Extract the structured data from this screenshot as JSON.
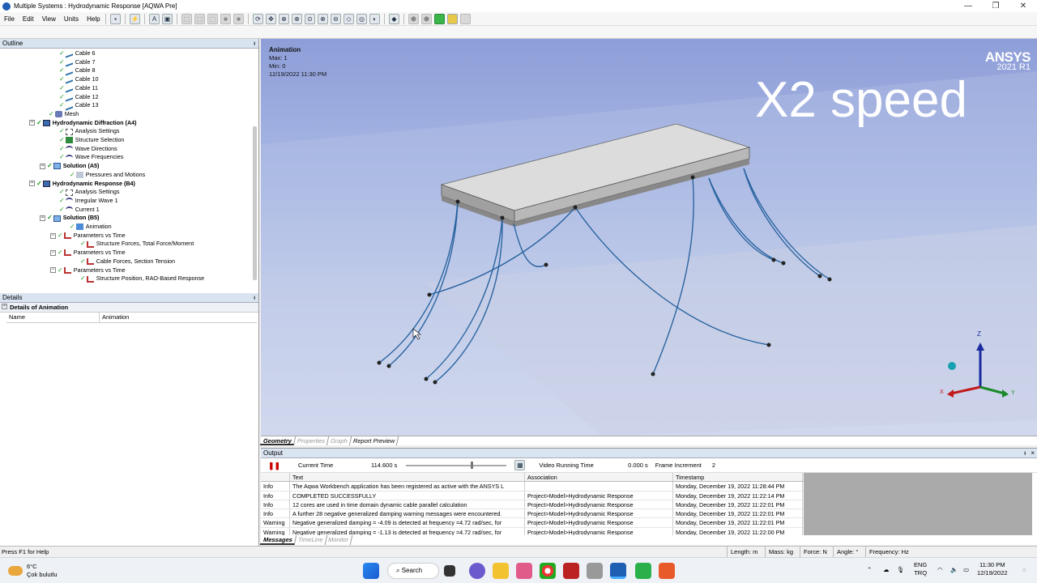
{
  "window": {
    "title": "Multiple Systems : Hydrodynamic Response [AQWA Pre]"
  },
  "menu": [
    "File",
    "Edit",
    "View",
    "Units",
    "Help"
  ],
  "outline": {
    "header": "Outline",
    "pin": "ᵻ",
    "nodes": [
      {
        "label": "Cable 6",
        "depth": 5,
        "icon": "cable-icon",
        "bold": false
      },
      {
        "label": "Cable 7",
        "depth": 5,
        "icon": "cable-icon",
        "bold": false
      },
      {
        "label": "Cable 8",
        "depth": 5,
        "icon": "cable-icon",
        "bold": false
      },
      {
        "label": "Cable 10",
        "depth": 5,
        "icon": "cable-icon",
        "bold": false
      },
      {
        "label": "Cable 11",
        "depth": 5,
        "icon": "cable-icon",
        "bold": false
      },
      {
        "label": "Cable 12",
        "depth": 5,
        "icon": "cable-icon",
        "bold": false
      },
      {
        "label": "Cable 13",
        "depth": 5,
        "icon": "cable-icon",
        "bold": false
      },
      {
        "label": "Mesh",
        "depth": 4,
        "icon": "mesh-icon",
        "bold": false
      },
      {
        "label": "Hydrodynamic Diffraction (A4)",
        "depth": 3,
        "icon": "system-icon",
        "bold": true,
        "exp": "−"
      },
      {
        "label": "Analysis Settings",
        "depth": 5,
        "icon": "settings-icon",
        "bold": false
      },
      {
        "label": "Structure Selection",
        "depth": 5,
        "icon": "structure-icon",
        "bold": false
      },
      {
        "label": "Wave Directions",
        "depth": 5,
        "icon": "wave-icon",
        "bold": false
      },
      {
        "label": "Wave Frequencies",
        "depth": 5,
        "icon": "wave-icon",
        "bold": false
      },
      {
        "label": "Solution (A5)",
        "depth": 4,
        "icon": "solution-icon",
        "bold": true,
        "exp": "−"
      },
      {
        "label": "Pressures and Motions",
        "depth": 6,
        "icon": "result-icon",
        "bold": false
      },
      {
        "label": "Hydrodynamic Response (B4)",
        "depth": 3,
        "icon": "system-icon",
        "bold": true,
        "exp": "−"
      },
      {
        "label": "Analysis Settings",
        "depth": 5,
        "icon": "settings-icon",
        "bold": false
      },
      {
        "label": "Irregular Wave 1",
        "depth": 5,
        "icon": "wave-icon",
        "bold": false
      },
      {
        "label": "Current 1",
        "depth": 5,
        "icon": "wave-icon",
        "bold": false
      },
      {
        "label": "Solution (B5)",
        "depth": 4,
        "icon": "solution-icon",
        "bold": true,
        "exp": "−"
      },
      {
        "label": "Animation",
        "depth": 6,
        "icon": "animation-icon",
        "bold": false
      },
      {
        "label": "Parameters vs Time",
        "depth": 5,
        "icon": "graph-icon",
        "bold": false,
        "exp": "−"
      },
      {
        "label": "Structure Forces, Total Force/Moment",
        "depth": 7,
        "icon": "graph-icon",
        "bold": false
      },
      {
        "label": "Parameters vs Time",
        "depth": 5,
        "icon": "graph-icon",
        "bold": false,
        "exp": "−"
      },
      {
        "label": "Cable Forces, Section Tension",
        "depth": 7,
        "icon": "graph-icon",
        "bold": false
      },
      {
        "label": "Parameters vs Time",
        "depth": 5,
        "icon": "graph-icon",
        "bold": false,
        "exp": "−"
      },
      {
        "label": "Structure Position, RAO-Based Response",
        "depth": 7,
        "icon": "graph-icon",
        "bold": false
      }
    ]
  },
  "details": {
    "header": "Details",
    "pin": "ᵻ",
    "group": "Details of Animation",
    "rows": [
      {
        "key": "Name",
        "value": "Animation"
      }
    ]
  },
  "viewport": {
    "anno_title": "Animation",
    "anno_max": "Max: 1",
    "anno_min": "Min: 0",
    "anno_date": "12/19/2022 11:30 PM",
    "brand": "ANSYS",
    "brand_version": "2021 R1",
    "overlay_text": "X2 speed",
    "axis_z": "Z",
    "axis_x": "X",
    "axis_y": "Y"
  },
  "view_tabs": [
    {
      "label": "Geometry",
      "active": true
    },
    {
      "label": "Properties",
      "active": false
    },
    {
      "label": "Graph",
      "active": false
    },
    {
      "label": "Report Preview",
      "active": false
    }
  ],
  "output": {
    "header": "Output",
    "pin": "ᵻ",
    "close": "×",
    "current_time_label": "Current Time",
    "current_time_value": "114.600 s",
    "current_time_fraction": 0.64,
    "video_time_label": "Video Running Time",
    "video_time_value": "0.000 s",
    "frame_inc_label": "Frame Increment",
    "frame_inc_value": "2",
    "columns": [
      "",
      "Text",
      "Association",
      "Timestamp"
    ],
    "rows": [
      [
        "Info",
        "The Aqwa Workbench application has been registered as active with the ANSYS L",
        "",
        "Monday, December 19, 2022 11:28:44 PM"
      ],
      [
        "Info",
        "COMPLETED SUCCESSFULLY",
        "Project>Model>Hydrodynamic Response",
        "Monday, December 19, 2022 11:22:14 PM"
      ],
      [
        "Info",
        "12 cores are used in time domain dynamic cable parallel calculation",
        "Project>Model>Hydrodynamic Response",
        "Monday, December 19, 2022 11:22:01 PM"
      ],
      [
        "Info",
        "A further 28 negative generalized damping warning messages were encountered.",
        "Project>Model>Hydrodynamic Response",
        "Monday, December 19, 2022 11:22:01 PM"
      ],
      [
        "Warning",
        "Negative generalized damping = -4.09 is detected at frequency =4.72 rad/sec, for",
        "Project>Model>Hydrodynamic Response",
        "Monday, December 19, 2022 11:22:01 PM"
      ],
      [
        "Warning",
        "Negative generalized damping = -1.13 is detected at frequency =4.72 rad/sec, for",
        "Project>Model>Hydrodynamic Response",
        "Monday, December 19, 2022 11:22:00 PM"
      ]
    ],
    "tabs": [
      {
        "label": "Messages",
        "active": true
      },
      {
        "label": "TimeLine",
        "active": false
      },
      {
        "label": "Monitor",
        "active": false
      }
    ]
  },
  "status": {
    "help": "Press F1 for Help",
    "length": "Length: m",
    "mass": "Mass: kg",
    "force": "Force: N",
    "angle": "Angle: °",
    "frequency": "Frequency: Hz"
  },
  "taskbar": {
    "temp": "6°C",
    "weather": "Çok bulutlu",
    "search": "Search",
    "lang1": "ENG",
    "lang2": "TRQ",
    "time": "11:30 PM",
    "date": "12/19/2022"
  },
  "colors": {
    "cable": "#2a64a0",
    "panel_header": "#d9e4f1",
    "accent": "#1e5fb4"
  }
}
